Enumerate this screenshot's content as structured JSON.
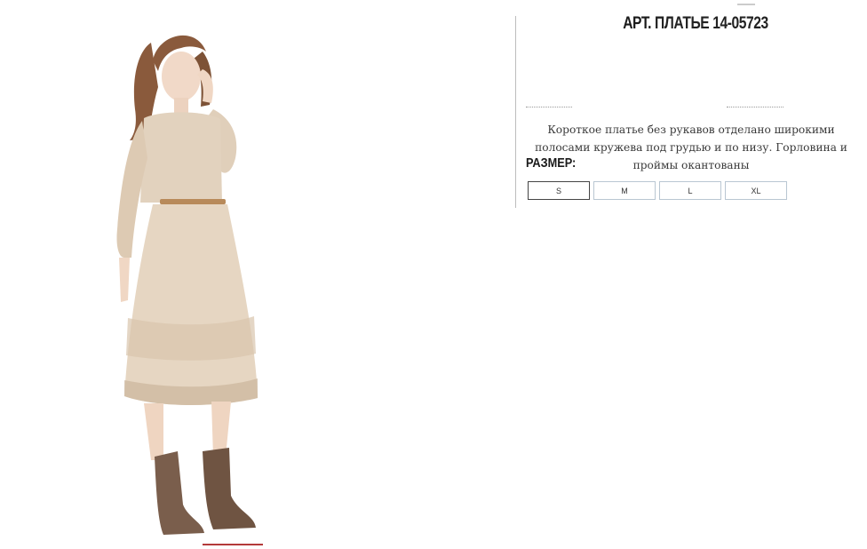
{
  "product": {
    "title_prefix": "АРТ.",
    "title_name": "ПЛАТЬЕ 14-05723",
    "description": "Короткое платье без рукавов отделано широкими полосами кружева под грудью и по низу. Горловина и проймы окантованы",
    "size_label": "РАЗМЕР:",
    "sizes": [
      "S",
      "M",
      "L",
      "XL"
    ],
    "selected_size": "S"
  },
  "colors": {
    "accent": "#b43a3a",
    "dress": "#e2d2be",
    "boots": "#7a5e4c",
    "hair": "#8a5a3c"
  }
}
